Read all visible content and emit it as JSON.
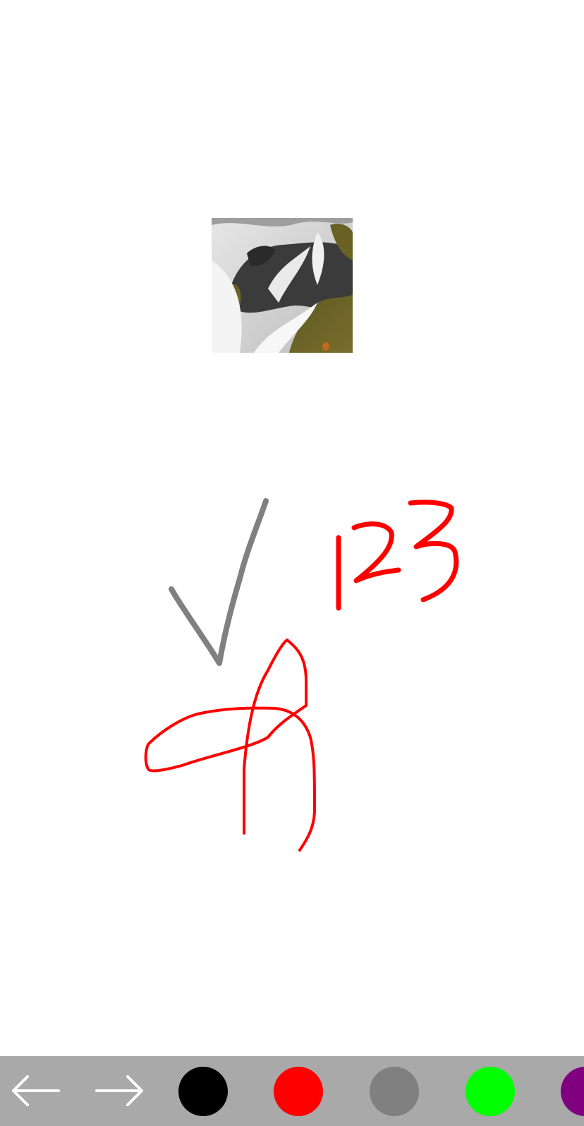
{
  "canvas": {
    "background": "#ffffff",
    "photo": {
      "icon": "waterfall-photo",
      "description_colors": [
        "#d9d9d9",
        "#3a3a3a",
        "#6b6a2a"
      ]
    },
    "strokes": [
      {
        "name": "checkmark-stroke",
        "color": "#808080"
      },
      {
        "name": "digit-1-stroke",
        "color": "#ff0000"
      },
      {
        "name": "digit-2-stroke",
        "color": "#ff0000"
      },
      {
        "name": "digit-3-stroke",
        "color": "#ff0000"
      },
      {
        "name": "loop-stroke",
        "color": "#ff0000"
      }
    ]
  },
  "toolbar": {
    "background": "#a9a9a9",
    "undo_icon": "arrow-left-icon",
    "redo_icon": "arrow-right-icon",
    "colors": [
      {
        "name": "black",
        "hex": "#000000"
      },
      {
        "name": "red",
        "hex": "#ff0000"
      },
      {
        "name": "gray",
        "hex": "#808080"
      },
      {
        "name": "green",
        "hex": "#00ff00"
      },
      {
        "name": "purple",
        "hex": "#800080"
      }
    ]
  }
}
